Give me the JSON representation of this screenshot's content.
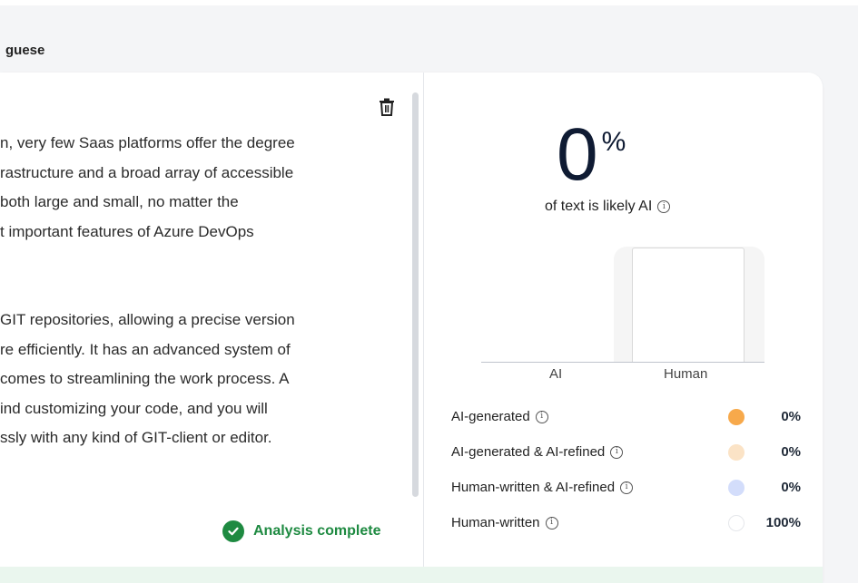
{
  "header": {
    "language_label": "guese"
  },
  "editor": {
    "paragraph1": [
      "n, very few Saas platforms offer the degree",
      "rastructure and a broad array of accessible",
      " both large and small, no matter the",
      "t important features of Azure DevOps"
    ],
    "paragraph2": [
      " GIT repositories, allowing a precise version",
      "re efficiently. It has an advanced system of",
      " comes to streamlining the work process. A",
      "ind customizing your code, and you will",
      "ssly with any kind of GIT-client or editor."
    ],
    "status": "Analysis complete"
  },
  "result": {
    "score": "0",
    "score_unit": "%",
    "subtitle": "of text is likely AI"
  },
  "chart_data": {
    "type": "bar",
    "categories": [
      "AI",
      "Human"
    ],
    "values": [
      0,
      100
    ],
    "ylim": [
      0,
      100
    ],
    "grid": false
  },
  "legend": [
    {
      "label": "AI-generated",
      "value": "0%",
      "color": "#f7a94b",
      "fill": true
    },
    {
      "label": "AI-generated & AI-refined",
      "value": "0%",
      "color": "#fbe3c6",
      "fill": true
    },
    {
      "label": "Human-written & AI-refined",
      "value": "0%",
      "color": "#d3ddfb",
      "fill": true
    },
    {
      "label": "Human-written",
      "value": "100%",
      "color": "#ffffff",
      "fill": false
    }
  ],
  "icons": {
    "delete": "trash-icon",
    "status": "check-circle-icon",
    "info": "info-icon"
  }
}
